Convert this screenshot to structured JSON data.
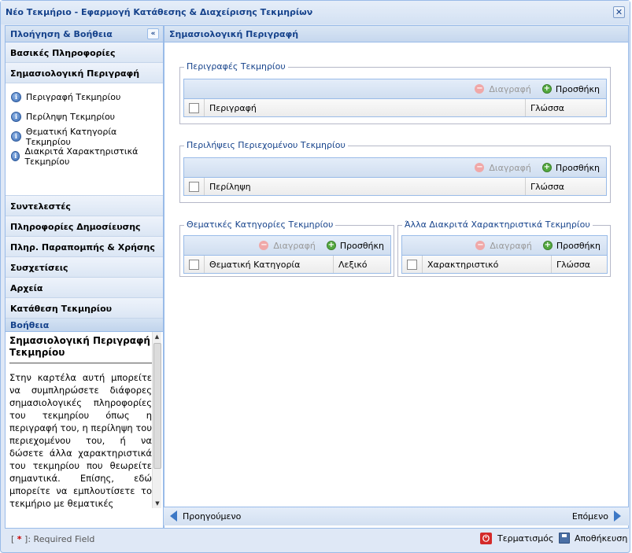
{
  "window": {
    "title": "Νέο Τεκμήριο - Εφαρμογή Κατάθεσης & Διαχείρισης Τεκμηρίων",
    "close_glyph": "✕"
  },
  "nav": {
    "header": "Πλοήγηση & Βοήθεια",
    "collapse_glyph": "«",
    "sections_top": [
      "Βασικές Πληροφορίες",
      "Σημασιολογική Περιγραφή"
    ],
    "sub_items": [
      "Περιγραφή Τεκμηρίου",
      "Περίληψη Τεκμηρίου",
      "Θεματική Κατηγορία Τεκμηρίου",
      "Διακριτά Χαρακτηριστικά Τεκμηρίου"
    ],
    "sections_bottom": [
      "Συντελεστές",
      "Πληροφορίες Δημοσίευσης",
      "Πληρ. Παραπομπής & Χρήσης",
      "Συσχετίσεις",
      "Αρχεία",
      "Κατάθεση Τεκμηρίου"
    ],
    "info_glyph": "i"
  },
  "help": {
    "header": "Βοήθεια",
    "title": "Σημασιολογική Περιγραφή Τεκμηρίου",
    "text": "Στην καρτέλα αυτή μπορείτε να συμπληρώσετε διάφορες σημασιολογικές πληροφορίες του τεκμηρίου όπως η περιγραφή του, η περίληψη του περιεχομένου του, ή να δώσετε άλλα χαρακτηριστικά του τεκμηρίου που θεωρείτε σημαντικά. Επίσης, εδώ μπορείτε να εμπλουτίσετε το τεκμήριο με θεματικές"
  },
  "main": {
    "header": "Σημασιολογική Περιγραφή",
    "delete_label": "Διαγραφή",
    "add_label": "Προσθήκη",
    "descriptions": {
      "legend": "Περιγραφές Τεκμηρίου",
      "columns": [
        "Περιγραφή",
        "Γλώσσα"
      ]
    },
    "abstracts": {
      "legend": "Περιλήψεις Περιεχομένου Τεκμηρίου",
      "columns": [
        "Περίληψη",
        "Γλώσσα"
      ]
    },
    "categories": {
      "legend": "Θεματικές Κατηγορίες Τεκμηρίου",
      "columns": [
        "Θεματική Κατηγορία",
        "Λεξικό"
      ]
    },
    "characteristics": {
      "legend": "Άλλα Διακριτά Χαρακτηριστικά Τεκμηρίου",
      "columns": [
        "Χαρακτηριστικό",
        "Γλώσσα"
      ]
    }
  },
  "bottom_nav": {
    "prev": "Προηγούμενο",
    "next": "Επόμενο"
  },
  "footer": {
    "required_star": "*",
    "required_text": ": Required Field",
    "cancel": "Τερματισμός",
    "save": "Αποθήκευση"
  },
  "colors": {
    "accent": "#15428b",
    "border": "#99bbe8",
    "arrow": "#3c78c6",
    "cancel_icon": "#d42a2a",
    "add_icon": "#53a93f"
  }
}
